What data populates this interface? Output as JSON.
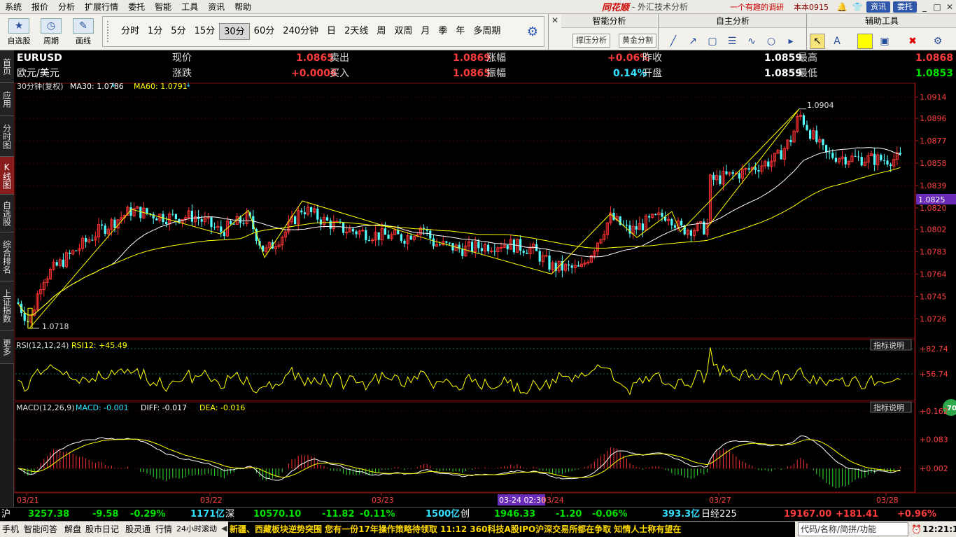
{
  "menu": [
    "系统",
    "报价",
    "分析",
    "扩展行情",
    "委托",
    "智能",
    "工具",
    "资讯",
    "帮助"
  ],
  "titlebar": {
    "brand": "同花顺",
    "title": "- 外汇技术分析",
    "survey": "一个有趣的调研",
    "version": "本本0915",
    "btn_news": "资讯",
    "btn_trade": "委托"
  },
  "toolbar": {
    "big": [
      {
        "label": "自选股",
        "icon": "star-icon"
      },
      {
        "label": "周期",
        "icon": "clock-icon"
      },
      {
        "label": "画线",
        "icon": "pencil-icon"
      }
    ],
    "periods": [
      "分时",
      "1分",
      "5分",
      "15分",
      "30分",
      "60分",
      "240分钟",
      "日",
      "2天线",
      "周",
      "双周",
      "月",
      "季",
      "年",
      "多周期"
    ],
    "active_period": "30分",
    "smart_title": "智能分析",
    "smart_btns": [
      "撑压分析",
      "黄金分割"
    ],
    "self_title": "自主分析",
    "aux_title": "辅助工具"
  },
  "left_tabs": [
    "首页",
    "应用",
    "分时图",
    "K线图",
    "自选股",
    "综合排名",
    "上证指数",
    "更多"
  ],
  "active_tab": "K线图",
  "info": {
    "symbol": "EURUSD",
    "name": "欧元/美元",
    "row1": [
      {
        "label": "现价",
        "value": "1.0865"
      },
      {
        "label": "卖出",
        "value": "1.0869"
      },
      {
        "label": "涨幅",
        "value": "+0.06%"
      },
      {
        "label": "昨收",
        "value": "1.0859"
      },
      {
        "label": "最高",
        "value": "1.0868"
      }
    ],
    "row2": [
      {
        "label": "涨跌",
        "value": "+0.0006"
      },
      {
        "label": "买入",
        "value": "1.0865"
      },
      {
        "label": "振幅",
        "value": "0.14%"
      },
      {
        "label": "开盘",
        "value": "1.0859"
      },
      {
        "label": "最低",
        "value": "1.0853"
      }
    ]
  },
  "colors": {
    "up": "#ff3232",
    "down": "#54ffff",
    "ma30": "#ffffff",
    "ma60": "#ffff00",
    "price_hl": "#6a2bb8",
    "text_red": "#ff3c3c",
    "text_green": "#00e000",
    "text_cyan": "#36e0ff"
  },
  "chart_data": {
    "type": "candlestick",
    "main": {
      "title": "30分钟(复权)",
      "ma30_label": "MA30: 1.0786",
      "ma60_label": "MA60: 1.0791",
      "y_ticks": [
        "1.0914",
        "1.0896",
        "1.0877",
        "1.0858",
        "1.0839",
        "1.0820",
        "1.0802",
        "1.0783",
        "1.0764",
        "1.0745",
        "1.0726"
      ],
      "ylim": [
        1.0712,
        1.0918
      ],
      "current": "1.0825",
      "annot_high": "1.0904",
      "annot_low": "1.0718",
      "x_labels": [
        "03/21",
        "03/22",
        "03/23",
        "03/24",
        "03/27",
        "03/28"
      ],
      "cursor_label": "03-24 02:30"
    },
    "rsi": {
      "title": "RSI(12,12,24)",
      "value_label": "RSI12: +45.49",
      "y_ticks": [
        "+82.74",
        "+56.74"
      ],
      "button": "指标说明"
    },
    "macd": {
      "title": "MACD(12,26,9)",
      "macd_label": "MACD: -0.001",
      "diff_label": "DIFF: -0.017",
      "dea_label": "DEA: -0.016",
      "y_ticks": [
        "+0.162",
        "+0.083",
        "+0.002"
      ],
      "button": "指标说明"
    },
    "badge": "70"
  },
  "status": {
    "sh_label": "沪",
    "sh_val": "3257.38",
    "sh_chg": "-9.58",
    "sh_pct": "-0.29%",
    "sh_amt": "1171亿",
    "sz_label": "深",
    "sz_val": "10570.10",
    "sz_chg": "-11.82",
    "sz_pct": "-0.11%",
    "sz_amt": "1500亿",
    "cy_label": "创",
    "cy_val": "1946.33",
    "cy_chg": "-1.20",
    "cy_pct": "-0.06%",
    "cy_amt": "393.3亿",
    "nk_label": "日经225",
    "nk_val": "19167.00",
    "nk_chg": "+181.41",
    "nk_pct": "+0.96%"
  },
  "bottom": {
    "tabs": [
      "手机",
      "智能问答",
      "解盘",
      "股市日记",
      "股灵通",
      "行情",
      "24小时滚动"
    ],
    "news": "新疆、西藏板块逆势突围      您有一份17年操作策略待领取      11:12 360科技A股IPO沪深交易所都在争取 知情人士称有望在",
    "search_placeholder": "代码/名称/简拼/功能",
    "time": "12:21:13"
  }
}
